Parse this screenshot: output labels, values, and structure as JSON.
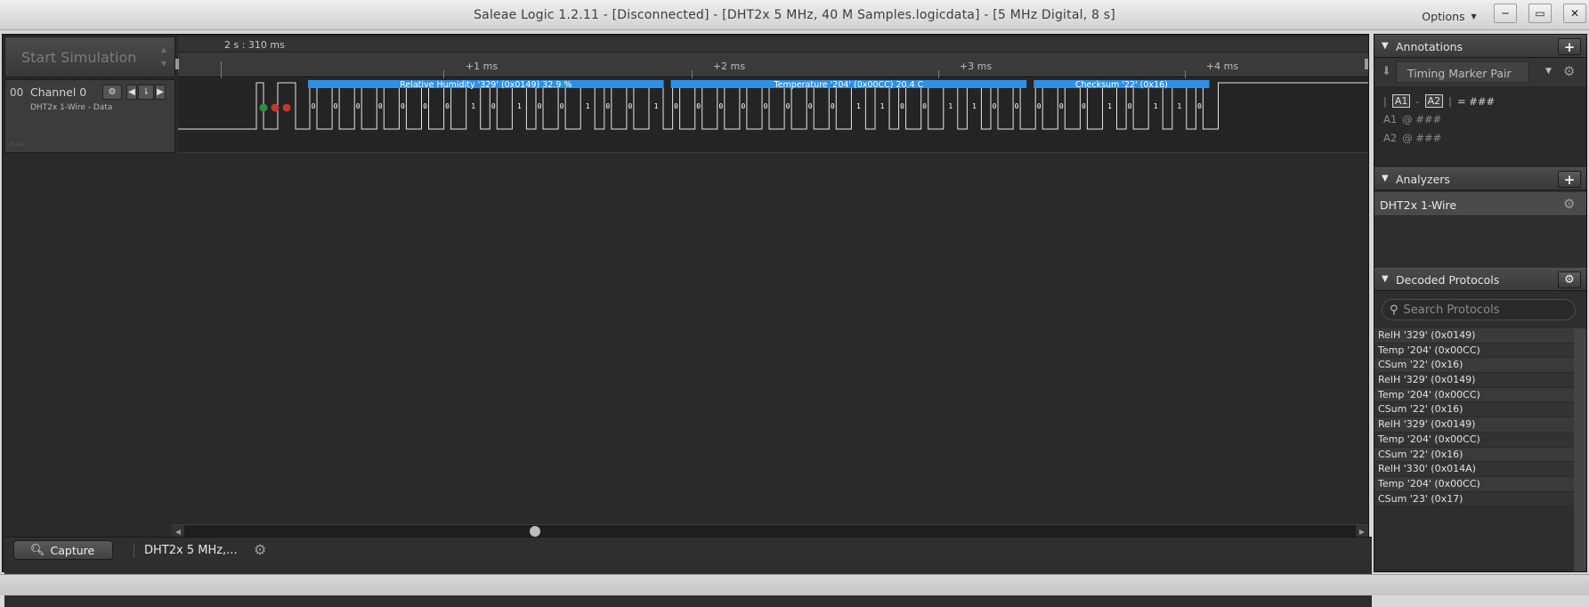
{
  "window": {
    "title": "Saleae Logic 1.2.11 - [Disconnected] - [DHT2x 5 MHz, 40 M Samples.logicdata] - [5 MHz Digital, 8 s]",
    "options_label": "Options",
    "controls": [
      "minimize-icon",
      "maximize-icon",
      "close-icon"
    ]
  },
  "toolbar": {
    "start_simulation_label": "Start Simulation"
  },
  "ruler": {
    "origin_label": "2 s : 310 ms",
    "ticks": [
      "+1 ms",
      "+2 ms",
      "+3 ms",
      "+4 ms"
    ]
  },
  "channel": {
    "number": "00",
    "name": "Channel 0",
    "subtitle": "DHT2x 1-Wire - Data"
  },
  "waveform": {
    "frames": [
      {
        "label": "Relative Humidity '329' (0x0149) 32.9 %",
        "from_bit": 0,
        "to_bit": 16
      },
      {
        "label": "Temperature '204' (0x00CC) 20.4 C",
        "from_bit": 16,
        "to_bit": 32
      },
      {
        "label": "Checksum '22' (0x16)",
        "from_bit": 32,
        "to_bit": 40
      }
    ],
    "bits": [
      0,
      0,
      0,
      0,
      0,
      0,
      0,
      1,
      0,
      1,
      0,
      0,
      1,
      0,
      0,
      1,
      0,
      0,
      0,
      0,
      0,
      0,
      0,
      0,
      1,
      1,
      0,
      0,
      1,
      1,
      0,
      0,
      0,
      0,
      0,
      1,
      0,
      1,
      1,
      0
    ],
    "markers": [
      {
        "color": "#2f8f4a"
      },
      {
        "color": "#c0392b"
      },
      {
        "color": "#c0392b"
      }
    ],
    "frame_color": "#2f90e8"
  },
  "tabs": {
    "capture_label": "Capture",
    "file_label": "DHT2x 5 MHz,..."
  },
  "annotations": {
    "title": "Annotations",
    "timing_marker": "Timing Marker Pair",
    "pair_a1": "A1",
    "pair_a2": "A2",
    "pair_value": "= ###",
    "a1_label": "A1",
    "a1_value": "@ ###",
    "a2_label": "A2",
    "a2_value": "@ ###"
  },
  "analyzers": {
    "title": "Analyzers",
    "items": [
      "DHT2x 1-Wire"
    ]
  },
  "decoded": {
    "title": "Decoded Protocols",
    "search_placeholder": "Search Protocols",
    "rows": [
      "RelH '329' (0x0149)",
      "Temp '204' (0x00CC)",
      "CSum '22' (0x16)",
      "RelH '329' (0x0149)",
      "Temp '204' (0x00CC)",
      "CSum '22' (0x16)",
      "RelH '329' (0x0149)",
      "Temp '204' (0x00CC)",
      "CSum '22' (0x16)",
      "RelH '330' (0x014A)",
      "Temp '204' (0x00CC)",
      "CSum '23' (0x17)"
    ]
  }
}
